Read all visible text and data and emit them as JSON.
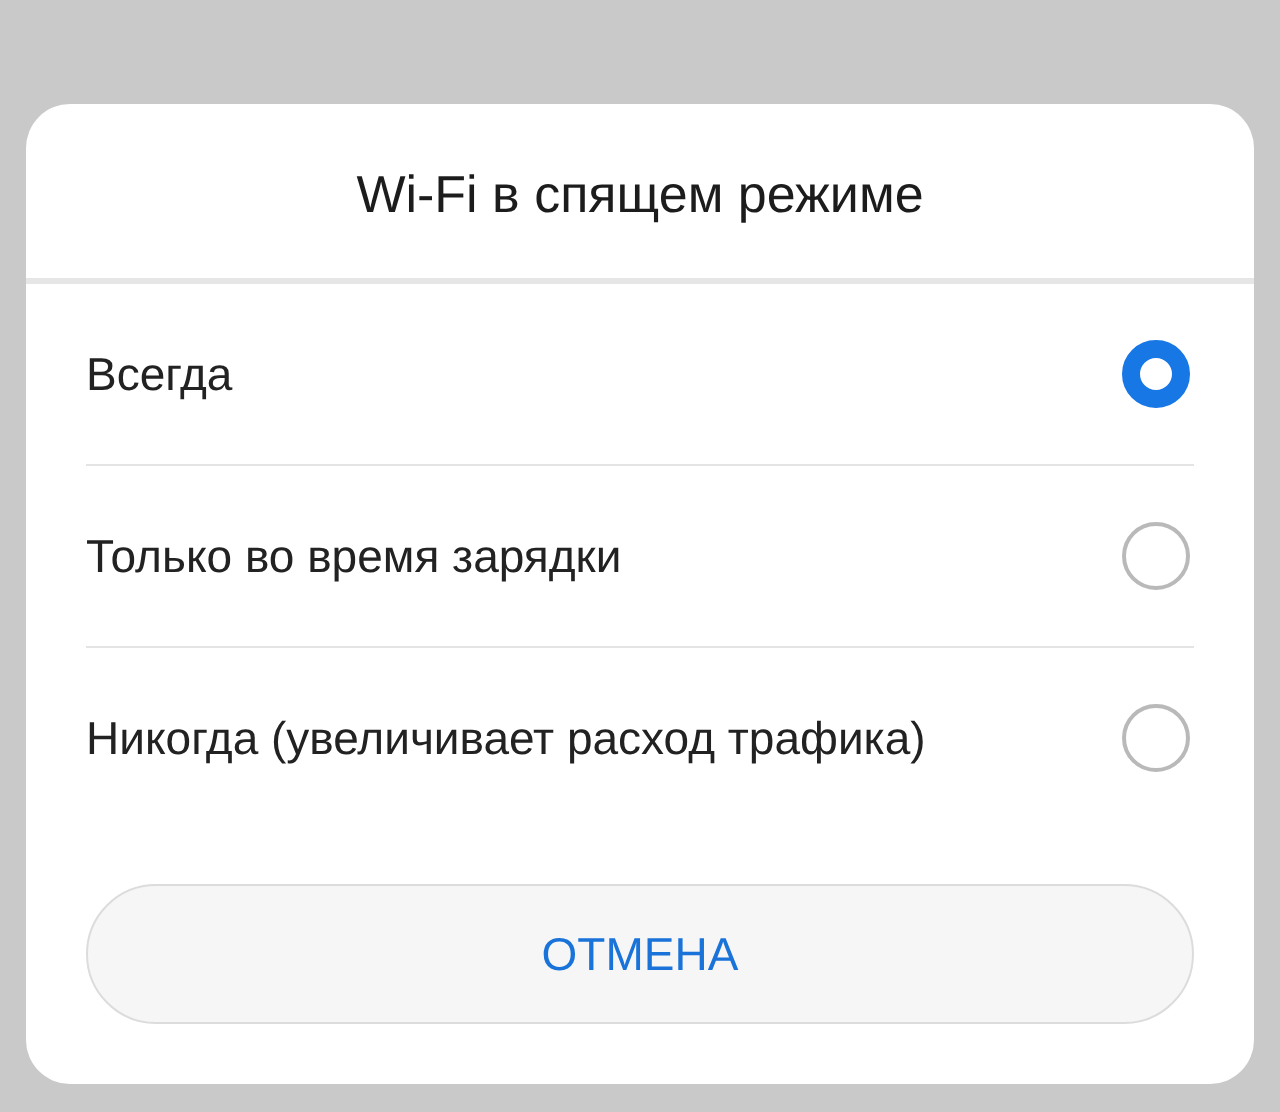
{
  "dialog": {
    "title": "Wi-Fi в спящем режиме"
  },
  "options": [
    {
      "label": "Всегда",
      "selected": true
    },
    {
      "label": "Только во время зарядки",
      "selected": false
    },
    {
      "label": "Никогда (увеличивает расход трафика)",
      "selected": false
    }
  ],
  "buttons": [
    "ОТМЕНА"
  ]
}
